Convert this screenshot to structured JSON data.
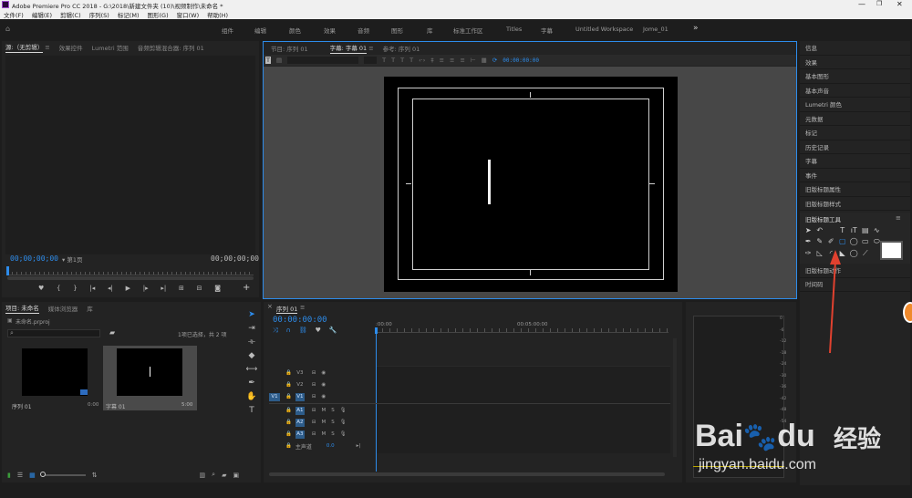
{
  "window": {
    "title": "Adobe Premiere Pro CC 2018 - G:\\2018\\新建文件夹 (10)\\视频制作\\未命名 *",
    "controls": [
      "minimize-icon",
      "restore-icon",
      "close-icon"
    ]
  },
  "menu": [
    "文件(F)",
    "编辑(E)",
    "剪辑(C)",
    "序列(S)",
    "标记(M)",
    "图形(G)",
    "窗口(W)",
    "帮助(H)"
  ],
  "workspaces": [
    "组件",
    "编辑",
    "颜色",
    "效果",
    "音频",
    "图形",
    "库",
    "标准工作区",
    "Titles",
    "字幕",
    "Untitled Workspace",
    "Jome_01"
  ],
  "workspaces_overflow": "»",
  "source_panel": {
    "tabs": [
      "源:（无剪辑）",
      "效果控件",
      "Lumetri 范围",
      "音频剪辑混合器: 序列 01"
    ],
    "menu_glyph": "≡",
    "timecode_left": "00;00;00;00",
    "page_label": "第1页",
    "timecode_right": "00;00;00;00",
    "add_glyph": "+"
  },
  "program_panel": {
    "tabs": [
      "节目: 序列 01",
      "字幕: 字幕 01",
      "参考: 序列 01"
    ],
    "menu_glyph": "≡",
    "timecode": "00:00:00:00"
  },
  "right_panel": {
    "items": [
      "信息",
      "效果",
      "基本图形",
      "基本声音",
      "Lumetri 颜色",
      "元数据",
      "标记",
      "历史记录",
      "字幕",
      "事件",
      "旧版标题属性",
      "旧版标题样式"
    ],
    "tool_panel_title": "旧版标题工具",
    "menu_glyph": "≡",
    "bottom_items": [
      "旧版标题动作",
      "时间码"
    ]
  },
  "project_panel": {
    "tabs": [
      "项目: 未命名",
      "媒体浏览器",
      "库"
    ],
    "file": "未命名.prproj",
    "selection_info": "1项已选择，共 2 项",
    "items": [
      {
        "name": "序列 01",
        "duration": "0:00"
      },
      {
        "name": "字幕 01",
        "duration": "5:00"
      }
    ]
  },
  "timeline_panel": {
    "tab": "序列 01",
    "close_glyph": "×",
    "menu_glyph": "≡",
    "timecode": "00:00:00:00",
    "ruler": [
      ":00:00",
      "00:05:00:00"
    ],
    "video_tracks": [
      {
        "src": "",
        "name": "V3"
      },
      {
        "src": "",
        "name": "V2"
      },
      {
        "src": "V1",
        "name": "V1"
      }
    ],
    "audio_tracks": [
      {
        "name": "A1",
        "m": "M",
        "s": "S"
      },
      {
        "name": "A2",
        "m": "M",
        "s": "S"
      },
      {
        "name": "A3",
        "m": "M",
        "s": "S"
      }
    ],
    "master": {
      "name": "主声道",
      "value": "0.0"
    }
  },
  "audio_meter": {
    "scale": [
      "0",
      "-6",
      "-12",
      "-18",
      "-24",
      "-30",
      "-36",
      "-42",
      "-48",
      "-54",
      "dB"
    ]
  },
  "watermark": {
    "brand": "Bai",
    "brand2": "du",
    "cn": "经验",
    "url": "jingyan.baidu.com"
  },
  "colors": {
    "accent": "#2d8ceb",
    "annotation_arrow": "#e0412f",
    "panel_bg": "#232323",
    "app_bg": "#1d1d1d"
  }
}
